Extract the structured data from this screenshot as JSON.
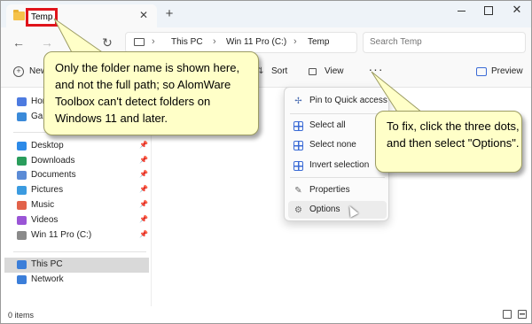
{
  "window": {
    "tab_title": "Temp",
    "tab_close": "✕",
    "new_tab": "+",
    "minimize": "",
    "maximize": "",
    "close": "✕"
  },
  "address": {
    "back": "←",
    "forward": "→",
    "up": "↑",
    "refresh": "↻",
    "crumbs": [
      "This PC",
      "Win 11 Pro (C:)",
      "Temp"
    ],
    "separator": "›",
    "search_placeholder": "Search Temp"
  },
  "commands": {
    "new_label": "New",
    "sort_label": "Sort",
    "view_label": "View",
    "more_label": "···",
    "preview_label": "Preview"
  },
  "sidebar": {
    "quick": [
      {
        "label": "Home",
        "icon": "home-icon",
        "color": "#4d7be0"
      },
      {
        "label": "Gallery",
        "icon": "gallery-icon",
        "color": "#3b8ad9"
      }
    ],
    "pinned": [
      {
        "label": "Desktop",
        "icon": "desktop-icon",
        "color": "#2d8ae8"
      },
      {
        "label": "Downloads",
        "icon": "downloads-icon",
        "color": "#2a9d5c"
      },
      {
        "label": "Documents",
        "icon": "documents-icon",
        "color": "#5b8bd6"
      },
      {
        "label": "Pictures",
        "icon": "pictures-icon",
        "color": "#3b9be0"
      },
      {
        "label": "Music",
        "icon": "music-icon",
        "color": "#e2624a"
      },
      {
        "label": "Videos",
        "icon": "videos-icon",
        "color": "#9a55d6"
      },
      {
        "label": "Win 11 Pro (C:)",
        "icon": "drive-icon",
        "color": "#8a8a8a"
      }
    ],
    "pin_glyph": "📌",
    "devices": [
      {
        "label": "This PC",
        "icon": "this-pc-icon",
        "color": "#3b7ed9"
      },
      {
        "label": "Network",
        "icon": "network-icon",
        "color": "#3b7ed9"
      }
    ]
  },
  "menu": {
    "items": [
      {
        "label": "Pin to Quick access",
        "icon": "pin-icon"
      },
      {
        "label": "Select all",
        "icon": "select-all-icon"
      },
      {
        "label": "Select none",
        "icon": "select-none-icon"
      },
      {
        "label": "Invert selection",
        "icon": "invert-selection-icon"
      },
      {
        "label": "Properties",
        "icon": "properties-icon"
      },
      {
        "label": "Options",
        "icon": "options-icon"
      }
    ]
  },
  "status": {
    "count": "0 items"
  },
  "callouts": {
    "left": "Only the folder name is shown here, and not the full path; so AlomWare Toolbox can't detect folders on Windows 11 and later.",
    "right": "To fix, click the three dots, and then select \"Options\"."
  },
  "colors": {
    "highlight_border": "#e0141b",
    "callout_bg": "#ffffc8",
    "accent": "#3b6bd6"
  }
}
